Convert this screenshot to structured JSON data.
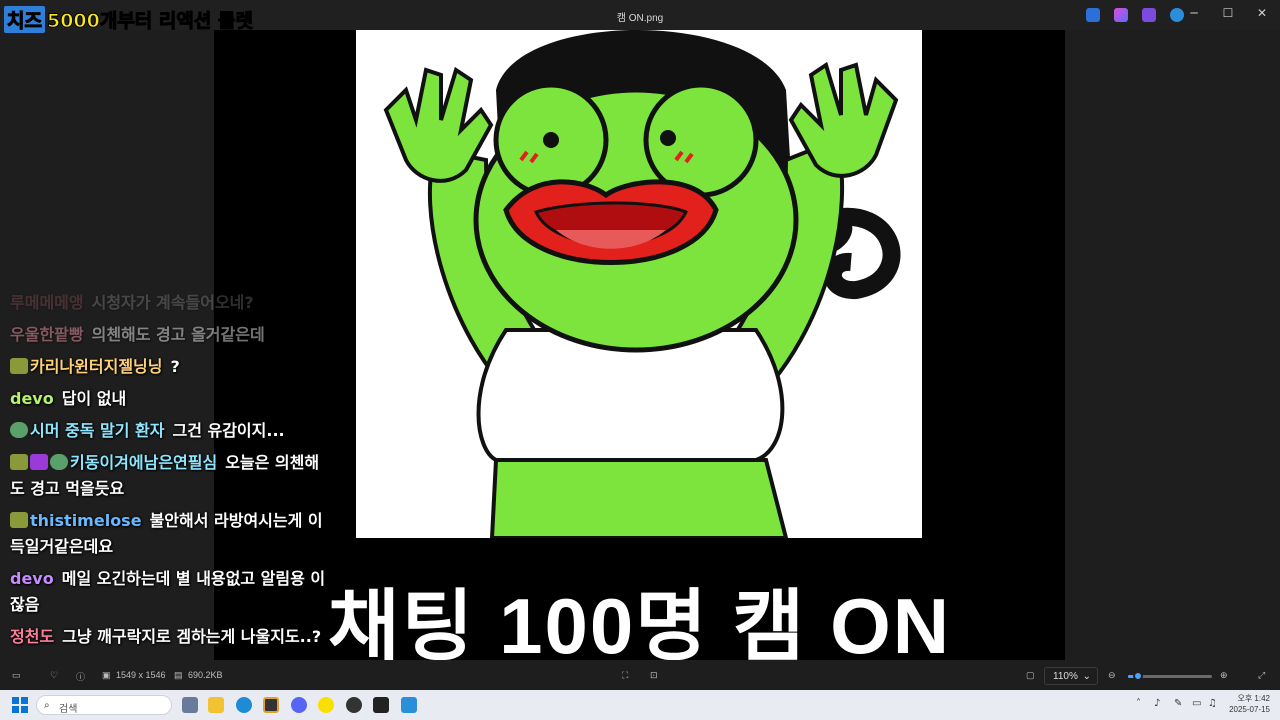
{
  "window": {
    "title": "캠 ON.png",
    "controls": {
      "minimize": "─",
      "maximize": "☐",
      "close": "✕"
    }
  },
  "banner": {
    "highlight": "치즈",
    "rest": "5000개부터 리액션 룰렛"
  },
  "image": {
    "caption": "채팅 100명 캠 ON"
  },
  "chat": {
    "messages": [
      {
        "name": "루메메메앵",
        "name_color": "#ff8a9a",
        "text": "시청자가 계속들어오네?"
      },
      {
        "name": "우울한팥빵",
        "name_color": "#ff9fb0",
        "text": "의첸해도 경고 올거같은데"
      },
      {
        "name": "카리나윈터지젤닝닝",
        "name_color": "#ffd27a",
        "text": "?"
      },
      {
        "name": "devo",
        "name_color": "#b7f06a",
        "text": "답이 없내"
      },
      {
        "name": "시머 중독 말기 환자",
        "name_color": "#8ee6ff",
        "text": "그건 유감이지..."
      },
      {
        "name": "키동이겨에남은연필심",
        "name_color": "#8ee6ff",
        "text": "오늘은 의첸해도 경고 먹을듯요"
      },
      {
        "name": "thistimelose",
        "name_color": "#6ab8ff",
        "text": "불안해서 라방여시는게 이득일거같은데요"
      },
      {
        "name": "devo",
        "name_color": "#c58cff",
        "text": "메일 오긴하는데 별 내용없고 알림용 이잖음"
      },
      {
        "name": "정천도",
        "name_color": "#ff7f9a",
        "text": "그냥 깨구락지로 겜하는게 나울지도..?"
      }
    ]
  },
  "viewer": {
    "dimensions": "1549 x 1546",
    "file_size": "690.2KB",
    "zoom": "110%",
    "zoom_fraction": 0.12
  },
  "taskbar": {
    "search_placeholder": "검색",
    "clock_time": "오후 1:42",
    "clock_date": "2025-07-15"
  },
  "colors": {
    "accent": "#4aa3ff",
    "frog_green": "#7de33d",
    "lips_red": "#e2201c"
  }
}
